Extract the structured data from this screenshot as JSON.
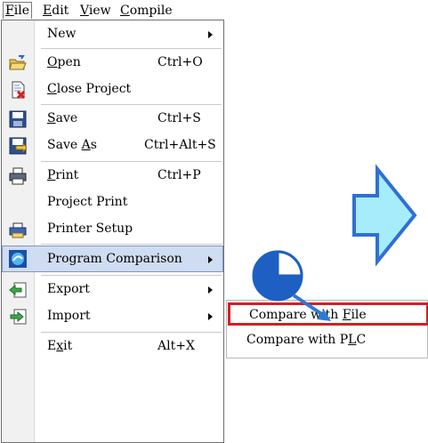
{
  "menubar": {
    "items": [
      {
        "label_pre": "F",
        "label_rest": "ile",
        "accel": "F"
      },
      {
        "label_pre": "E",
        "label_rest": "dit",
        "accel": "E"
      },
      {
        "label_pre": "V",
        "label_rest": "iew",
        "accel": "V"
      },
      {
        "label_pre": "C",
        "label_rest": "ompile",
        "accel": "C"
      }
    ]
  },
  "file_menu": {
    "new": {
      "label": "New"
    },
    "open": {
      "pre": "",
      "accel": "O",
      "rest": "pen",
      "shortcut": "Ctrl+O"
    },
    "close_project": {
      "pre": "",
      "accel": "C",
      "rest": "lose Project"
    },
    "save": {
      "pre": "",
      "accel": "S",
      "rest": "ave",
      "shortcut": "Ctrl+S"
    },
    "save_as": {
      "pre": "Save ",
      "accel": "A",
      "rest": "s",
      "shortcut": "Ctrl+Alt+S"
    },
    "print": {
      "pre": "",
      "accel": "P",
      "rest": "rint",
      "shortcut": "Ctrl+P"
    },
    "project_print": {
      "label": "Project Print"
    },
    "printer_setup": {
      "label": "Printer Setup"
    },
    "program_comparison": {
      "label": "Program Comparison"
    },
    "export": {
      "label": "Export"
    },
    "import": {
      "label": "Import"
    },
    "exit": {
      "pre": "E",
      "accel": "x",
      "rest": "it",
      "shortcut": "Alt+X"
    }
  },
  "submenu": {
    "compare_file": {
      "pre": "Compare with ",
      "accel": "F",
      "rest": "ile"
    },
    "compare_plc": {
      "pre": "Compare with P",
      "accel": "L",
      "rest": "C"
    }
  },
  "colors": {
    "highlight_box": "#d21f26",
    "callout_arrow": "#2e78d6",
    "step_arrow_fill": "#a7ecfb",
    "step_arrow_stroke": "#2f6fd6"
  }
}
